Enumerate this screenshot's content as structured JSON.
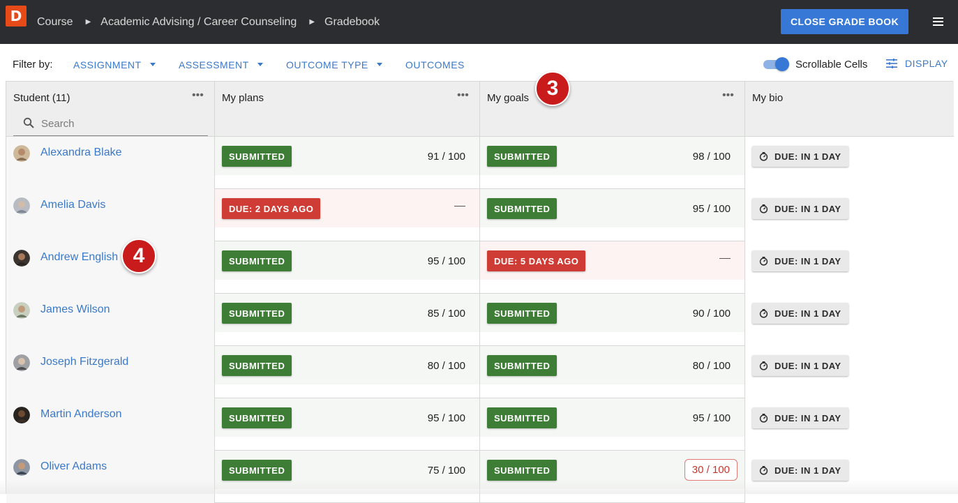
{
  "header": {
    "logo_letter": "D",
    "breadcrumbs": [
      "Course",
      "Academic Advising / Career Counseling",
      "Gradebook"
    ],
    "close_button": "CLOSE GRADE BOOK"
  },
  "filters": {
    "label": "Filter by:",
    "items": [
      "ASSIGNMENT",
      "ASSESSMENT",
      "OUTCOME TYPE",
      "OUTCOMES"
    ],
    "scrollable_cells_label": "Scrollable Cells",
    "scrollable_cells_on": true,
    "display_label": "DISPLAY"
  },
  "columns": {
    "student": "Student (11)",
    "plans": "My plans",
    "goals": "My goals",
    "bio": "My bio",
    "more": "•••"
  },
  "search": {
    "placeholder": "Search"
  },
  "rows": [
    {
      "name": "Alexandra Blake",
      "plans": {
        "status": "SUBMITTED",
        "score": "91 / 100"
      },
      "goals": {
        "status": "SUBMITTED",
        "score": "98 / 100"
      },
      "bio": "DUE: IN 1 DAY"
    },
    {
      "name": "Amelia Davis",
      "plans": {
        "status": "DUE: 2 DAYS AGO",
        "score": ""
      },
      "goals": {
        "status": "SUBMITTED",
        "score": "95 / 100"
      },
      "bio": "DUE: IN 1 DAY"
    },
    {
      "name": "Andrew English",
      "plans": {
        "status": "SUBMITTED",
        "score": "95 / 100"
      },
      "goals": {
        "status": "DUE: 5 DAYS AGO",
        "score": ""
      },
      "bio": "DUE: IN 1 DAY"
    },
    {
      "name": "James Wilson",
      "plans": {
        "status": "SUBMITTED",
        "score": "85 / 100"
      },
      "goals": {
        "status": "SUBMITTED",
        "score": "90 / 100"
      },
      "bio": "DUE: IN 1 DAY"
    },
    {
      "name": "Joseph Fitzgerald",
      "plans": {
        "status": "SUBMITTED",
        "score": "80 / 100"
      },
      "goals": {
        "status": "SUBMITTED",
        "score": "80 / 100"
      },
      "bio": "DUE: IN 1 DAY"
    },
    {
      "name": "Martin Anderson",
      "plans": {
        "status": "SUBMITTED",
        "score": "95 / 100"
      },
      "goals": {
        "status": "SUBMITTED",
        "score": "95 / 100"
      },
      "bio": "DUE: IN 1 DAY"
    },
    {
      "name": "Oliver Adams",
      "plans": {
        "status": "SUBMITTED",
        "score": "75 / 100"
      },
      "goals": {
        "status": "SUBMITTED",
        "score": "30 / 100"
      },
      "bio": "DUE: IN 1 DAY"
    }
  ],
  "callouts": {
    "step_3": "3",
    "step_4": "4"
  },
  "colors": {
    "topbar": "#2c2d30",
    "accent": "#3778d6",
    "submitted": "#3e7d36",
    "late": "#cf3c35",
    "low_score": "#c9352e",
    "callout": "#c91b1b"
  }
}
